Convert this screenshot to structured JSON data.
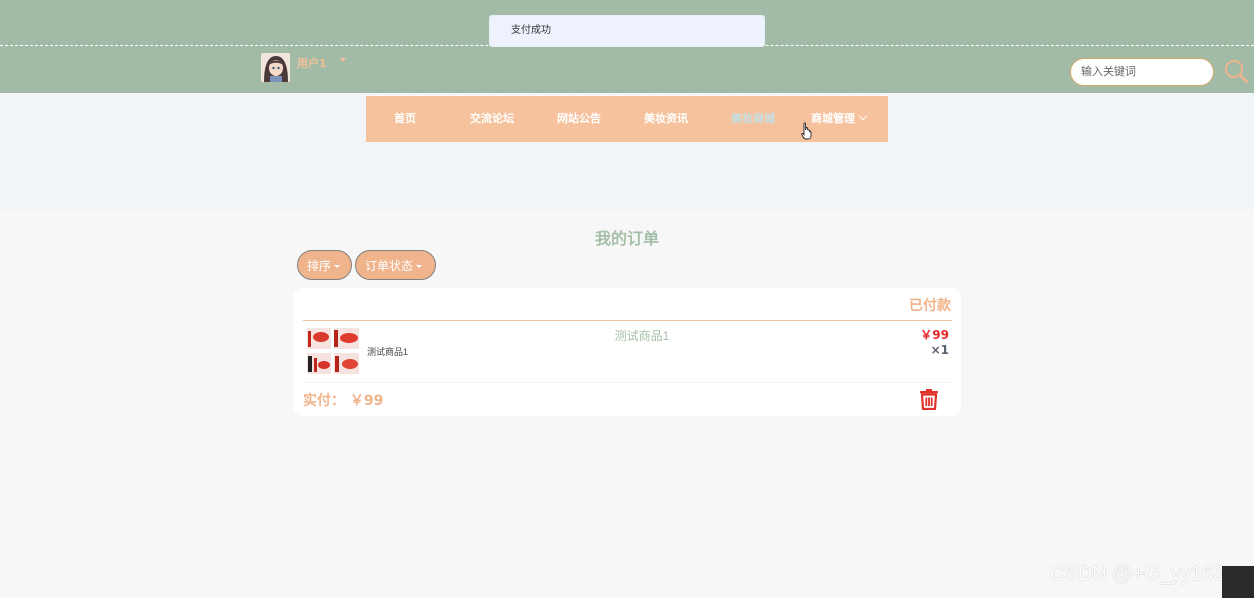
{
  "toast": {
    "message": "支付成功"
  },
  "user": {
    "name": "用户1"
  },
  "search": {
    "placeholder": "输入关键词"
  },
  "nav": {
    "items": [
      {
        "label": "首页"
      },
      {
        "label": "交流论坛"
      },
      {
        "label": "网站公告"
      },
      {
        "label": "美妆资讯"
      },
      {
        "label": "美妆商城",
        "active": true
      },
      {
        "label": "商城管理"
      }
    ]
  },
  "page": {
    "title": "我的订单"
  },
  "filters": {
    "sort_label": "排序",
    "status_label": "订单状态"
  },
  "order": {
    "status": "已付款",
    "product_name": "测试商品1",
    "product_desc": "测试商品1",
    "price": "￥99",
    "quantity": "×1",
    "paid_label": "实付：",
    "paid_amount": "￥99"
  },
  "watermark": "CSDN @+G_yy163",
  "colors": {
    "header_bg": "#a1bba7",
    "accent_peach": "#f5c29d",
    "title_green": "#a6bfa8",
    "price_red": "#e5292b"
  }
}
